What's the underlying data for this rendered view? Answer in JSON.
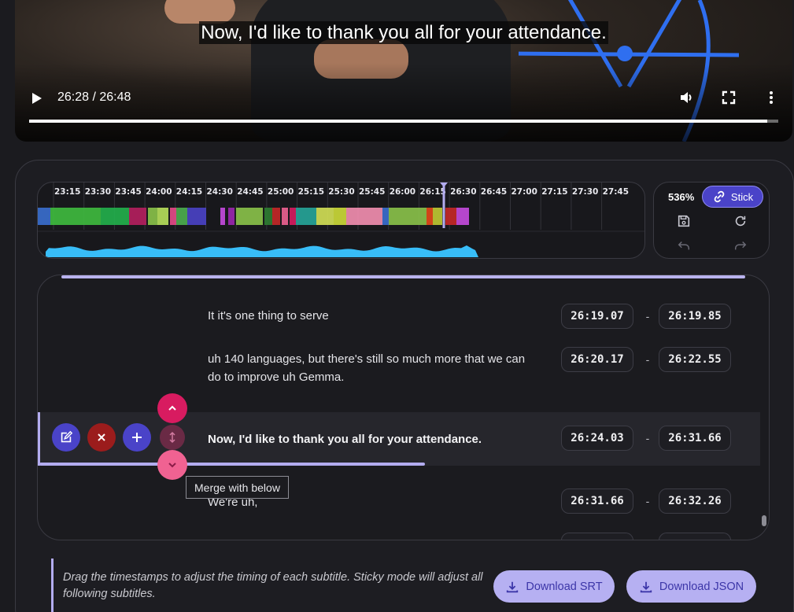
{
  "player": {
    "caption": "Now, I'd like to thank you all for your attendance.",
    "timecode": "26:28 / 26:48",
    "progress": 0.985
  },
  "timeline": {
    "ticks": [
      "23:15",
      "23:30",
      "23:45",
      "24:00",
      "24:15",
      "24:30",
      "24:45",
      "25:00",
      "25:15",
      "25:30",
      "25:45",
      "26:00",
      "26:15",
      "26:30",
      "26:45",
      "27:00",
      "27:15",
      "27:30",
      "27:45"
    ],
    "zoom": "536%",
    "stick_label": "Stick"
  },
  "subtitles": [
    {
      "text": "It it's one thing to serve",
      "start": "26:19.07",
      "end": "26:19.85"
    },
    {
      "text": "uh 140 languages, but there's still so much more that we can do to improve uh Gemma.",
      "start": "26:20.17",
      "end": "26:22.55"
    },
    {
      "text": "Now, I'd like to thank you all for your attendance.",
      "start": "26:24.03",
      "end": "26:31.66",
      "active": true
    },
    {
      "text": "We're uh,",
      "start": "26:31.66",
      "end": "26:32.26"
    }
  ],
  "dash": "-",
  "tooltip": "Merge with below",
  "hint": "Drag the timestamps to adjust the timing of each subtitle. Sticky mode will adjust all following subtitles.",
  "buttons": {
    "download_srt": "Download SRT",
    "download_json": "Download JSON"
  },
  "colors": {
    "accent": "#4a43c8",
    "accent_light": "#b6b0f2",
    "delete": "#9b1c1c",
    "move_up": "#d81b60",
    "move_down": "#f06292",
    "waveform": "#38bdf8"
  }
}
